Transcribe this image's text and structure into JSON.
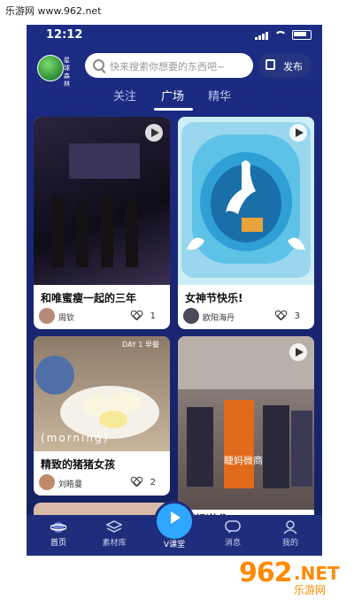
{
  "watermark": "乐游网 www.962.net",
  "corner_logo": {
    "big": "962",
    "net": ".NET",
    "sub": "乐游网"
  },
  "status": {
    "time": "12:12"
  },
  "header": {
    "avatar_label": "星球 森林",
    "search_placeholder": "快来搜索你想要的东西吧~",
    "publish_label": "发布"
  },
  "tabs": [
    {
      "label": "关注"
    },
    {
      "label": "广场",
      "active": true
    },
    {
      "label": "精华"
    }
  ],
  "cards": [
    {
      "title": "和唯蜜瘦一起的三年",
      "user": "周钦",
      "likes": "1"
    },
    {
      "title": "女神节快乐!",
      "user": "欧阳海丹",
      "likes": "3"
    },
    {
      "title": "精致的猪猪女孩",
      "user": "刘皓曼",
      "likes": "2",
      "image_text": "(morning)",
      "badge": "DAY 1 早餐"
    },
    {
      "title": "睫妈逆袭",
      "image_text": "睫妈微商"
    }
  ],
  "nav": [
    {
      "label": "首页",
      "active": true
    },
    {
      "label": "素材库"
    },
    {
      "label": "V课堂"
    },
    {
      "label": "消息"
    },
    {
      "label": "我的"
    }
  ],
  "colors": {
    "background": "#1c2d85",
    "nav": "#1f2e7c",
    "accent": "#2fa6ff"
  }
}
